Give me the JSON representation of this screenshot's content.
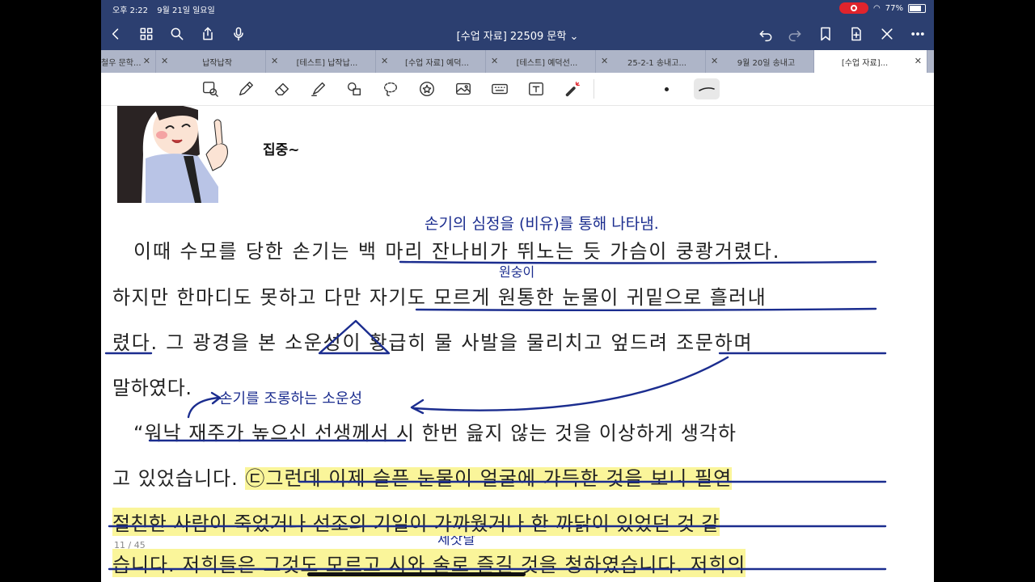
{
  "status_bar": {
    "time": "오후 2:22",
    "date": "9월 21일 일요일",
    "battery": "77%",
    "battery_level": 0.77
  },
  "toolbar": {
    "doc_title": "[수업 자료] 22509 문학 ⌄"
  },
  "tabs": [
    {
      "label": "철우 문학..."
    },
    {
      "label": "납작납작"
    },
    {
      "label": "[테스트] 납작납..."
    },
    {
      "label": "[수업 자료] 예덕..."
    },
    {
      "label": "[테스트] 예덕선..."
    },
    {
      "label": "25-2-1 송내고..."
    },
    {
      "label": "9월 20일 송내고"
    },
    {
      "label": "[수업 자료]..."
    }
  ],
  "annotations": {
    "focus": "집중~",
    "metaphor_note": "손기의 심정을 (비유)를 통해 나타냄.",
    "wonsung": "원숭이",
    "mock_note": "손기를 조롱하는 소운성",
    "jesanal": "제삿날"
  },
  "document": {
    "line1": "이때 수모를 당한 손기는 백 마리 잔나비가 뛰노는 듯 가슴이 쿵쾅거렸다.",
    "line2": "하지만 한마디도 못하고 다만 자기도 모르게 원통한 눈물이 귀밑으로 흘러내",
    "line3": "렸다. 그 광경을 본 소운성이 황급히 물 사발을 물리치고 엎드려 조문하며",
    "line4": "말하였다.",
    "line5": "“워낙 재주가 높으신 선생께서 시 한번 읊지 않는 것을 이상하게 생각하",
    "line6a": "고 있었습니다. ",
    "line6b": "㉢그런데 이제 슬픈 눈물이 얼굴에 가득한 것을 보니 필연",
    "line7": "절친한 사람이 죽었거나 선조의 기일이 가까웠거나 한 까닭이 있었던 것 같",
    "line8": "습니다. 저희들은 그것도 모르고 시와 술로 즐길 것을 청하였습니다. 저희의"
  },
  "page_indicator": "11 / 45",
  "colors": {
    "accent": "#2c3f70",
    "ink": "#1b2d8f",
    "highlight": "#faf59a"
  }
}
